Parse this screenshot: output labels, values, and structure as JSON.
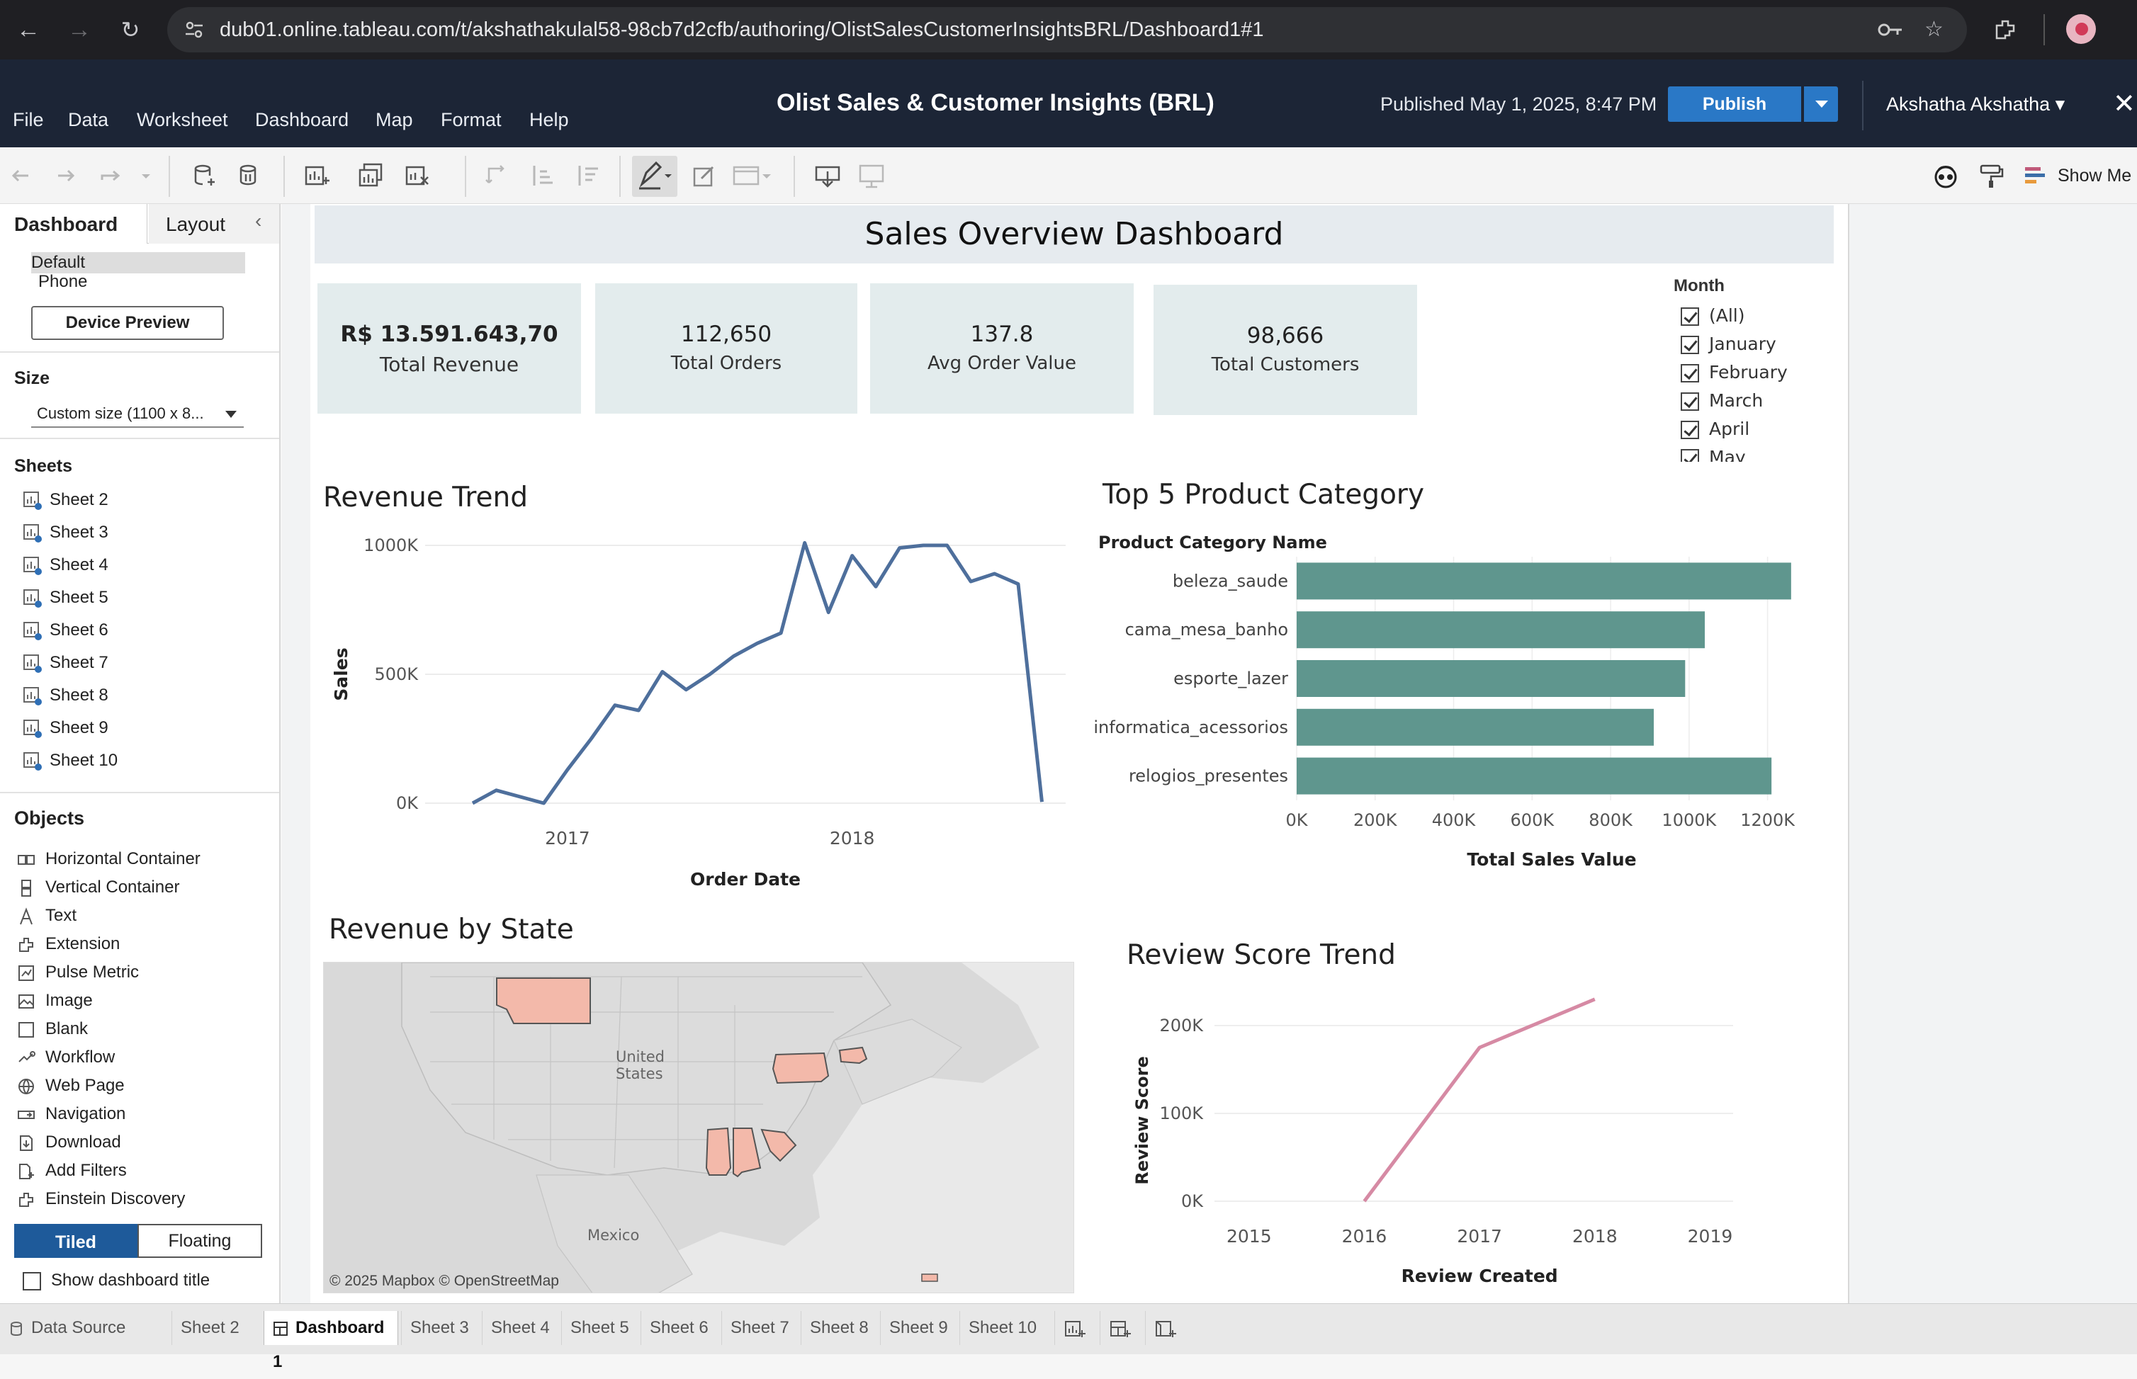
{
  "browser": {
    "url": "dub01.online.tableau.com/t/akshathakulal58-98cb7d2cfb/authoring/OlistSalesCustomerInsightsBRL/Dashboard1#1"
  },
  "app": {
    "menus": [
      "File",
      "Data",
      "Worksheet",
      "Dashboard",
      "Map",
      "Format",
      "Help"
    ],
    "workbook_title": "Olist Sales & Customer Insights (BRL)",
    "published": "Published May 1, 2025, 8:47 PM",
    "publish_label": "Publish",
    "user": "Akshatha Akshatha",
    "show_me": "Show Me"
  },
  "left_panel": {
    "tab_dashboard": "Dashboard",
    "tab_layout": "Layout",
    "device_default": "Default",
    "device_phone": "Phone",
    "device_preview": "Device Preview",
    "size_heading": "Size",
    "size_value": "Custom size (1100 x 8...",
    "sheets_heading": "Sheets",
    "sheets": [
      "Sheet 2",
      "Sheet 3",
      "Sheet 4",
      "Sheet 5",
      "Sheet 6",
      "Sheet 7",
      "Sheet 8",
      "Sheet 9",
      "Sheet 10"
    ],
    "objects_heading": "Objects",
    "objects": [
      "Horizontal Container",
      "Vertical Container",
      "Text",
      "Extension",
      "Pulse Metric",
      "Image",
      "Blank",
      "Workflow",
      "Web Page",
      "Navigation",
      "Download",
      "Add Filters",
      "Einstein Discovery"
    ],
    "tiled": "Tiled",
    "floating": "Floating",
    "show_title": "Show dashboard title"
  },
  "dashboard": {
    "title": "Sales Overview Dashboard",
    "kpis": [
      {
        "value": "R$ 13.591.643,70",
        "label": "Total Revenue"
      },
      {
        "value": "112,650",
        "label": "Total Orders"
      },
      {
        "value": "137.8",
        "label": "Avg Order Value"
      },
      {
        "value": "98,666",
        "label": "Total Customers"
      }
    ],
    "month_filter": {
      "title": "Month",
      "items": [
        "(All)",
        "January",
        "February",
        "March",
        "April",
        "May"
      ]
    },
    "revenue_trend_title": "Revenue Trend",
    "top5_title": "Top 5 Product Category",
    "map_title": "Revenue by State",
    "map_labels": {
      "country": "United States",
      "mexico": "Mexico",
      "credit": "© 2025 Mapbox  © OpenStreetMap"
    },
    "review_title": "Review Score Trend"
  },
  "chart_data": [
    {
      "type": "line",
      "title": "Revenue Trend",
      "xlabel": "Order Date",
      "ylabel": "Sales",
      "x_ticks": [
        "2017",
        "2018"
      ],
      "y_ticks": [
        "0K",
        "500K",
        "1000K"
      ],
      "ylim": [
        0,
        1000000
      ],
      "color": "#4e6f9c",
      "x": [
        "2016-09",
        "2016-10",
        "2016-12",
        "2017-01",
        "2017-02",
        "2017-03",
        "2017-04",
        "2017-05",
        "2017-06",
        "2017-07",
        "2017-08",
        "2017-09",
        "2017-10",
        "2017-11",
        "2017-12",
        "2018-01",
        "2018-02",
        "2018-03",
        "2018-04",
        "2018-05",
        "2018-06",
        "2018-07",
        "2018-08",
        "2018-09"
      ],
      "values": [
        0,
        50000,
        0,
        130000,
        250000,
        380000,
        360000,
        510000,
        440000,
        500000,
        570000,
        620000,
        660000,
        1010000,
        740000,
        960000,
        840000,
        990000,
        1000000,
        1000000,
        860000,
        890000,
        850000,
        5000
      ]
    },
    {
      "type": "bar",
      "title": "Top 5 Product Category",
      "category_header": "Product Category Name",
      "xlabel": "Total Sales Value",
      "categories": [
        "beleza_saude",
        "cama_mesa_banho",
        "esporte_lazer",
        "informatica_acessorios",
        "relogios_presentes"
      ],
      "values": [
        1260000,
        1040000,
        990000,
        910000,
        1210000
      ],
      "x_ticks": [
        "0K",
        "200K",
        "400K",
        "600K",
        "800K",
        "1000K",
        "1200K"
      ],
      "xlim": [
        0,
        1300000
      ],
      "color": "#5f968e"
    },
    {
      "type": "line",
      "title": "Review Score Trend",
      "xlabel": "Review Created",
      "ylabel": "Review Score",
      "x_ticks": [
        "2015",
        "2016",
        "2017",
        "2018",
        "2019"
      ],
      "y_ticks": [
        "0K",
        "100K",
        "200K"
      ],
      "ylim": [
        0,
        200000
      ],
      "color": "#d68aa4",
      "x": [
        2016,
        2017,
        2018
      ],
      "values": [
        0,
        175000,
        230000
      ]
    }
  ],
  "bottom_tabs": {
    "data_source": "Data Source",
    "tabs": [
      "Sheet 2",
      "Dashboard 1",
      "Sheet 3",
      "Sheet 4",
      "Sheet 5",
      "Sheet 6",
      "Sheet 7",
      "Sheet 8",
      "Sheet 9",
      "Sheet 10"
    ]
  }
}
